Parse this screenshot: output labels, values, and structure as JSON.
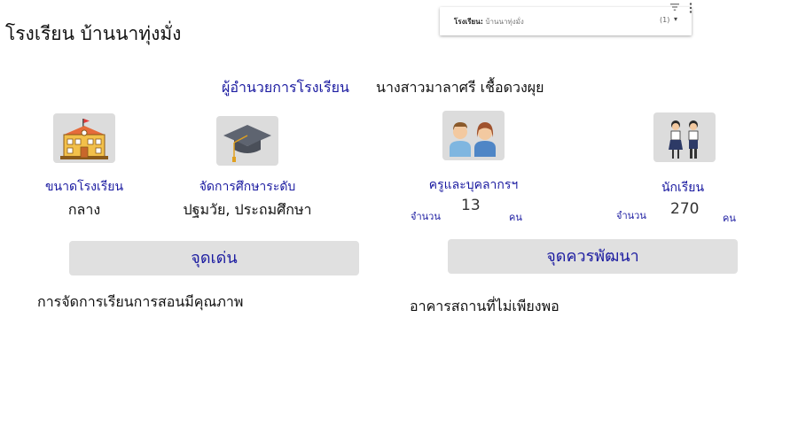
{
  "page": {
    "title": "โรงเรียน บ้านนาทุ่งมั่ง"
  },
  "filter": {
    "field_label": "โรงเรียน:",
    "field_value": "บ้านนาทุ่งมั่ง",
    "count": "(1)",
    "caret": "▾",
    "icons": [
      "filter-icon",
      "more-vert-icon"
    ]
  },
  "director": {
    "label": "ผู้อำนวยการโรงเรียน",
    "name": "นางสาวมาลาศรี เชื้อดวงผุย"
  },
  "school_size": {
    "label": "ขนาดโรงเรียน",
    "value": "กลาง",
    "icon": "school-building-icon"
  },
  "education_level": {
    "label": "จัดการศึกษาระดับ",
    "value": "ปฐมวัย, ประถมศึกษา",
    "icon": "graduation-cap-icon"
  },
  "teachers": {
    "label": "ครูและบุคลากรฯ",
    "prefix": "จำนวน",
    "count": "13",
    "unit": "คน",
    "icon": "teachers-icon"
  },
  "students": {
    "label": "นักเรียน",
    "prefix": "จำนวน",
    "count": "270",
    "unit": "คน",
    "icon": "students-icon"
  },
  "strengths": {
    "button_label": "จุดเด่น",
    "text": "การจัดการเรียนการสอนมีคุณภาพ"
  },
  "improvements": {
    "button_label": "จุดควรพัฒนา",
    "text": "อาคารสถานที่ไม่เพียงพอ"
  },
  "colors": {
    "accent": "#1a1aa0",
    "button_bg": "#e0e0e0",
    "icon_bg": "#dcdcdc"
  }
}
